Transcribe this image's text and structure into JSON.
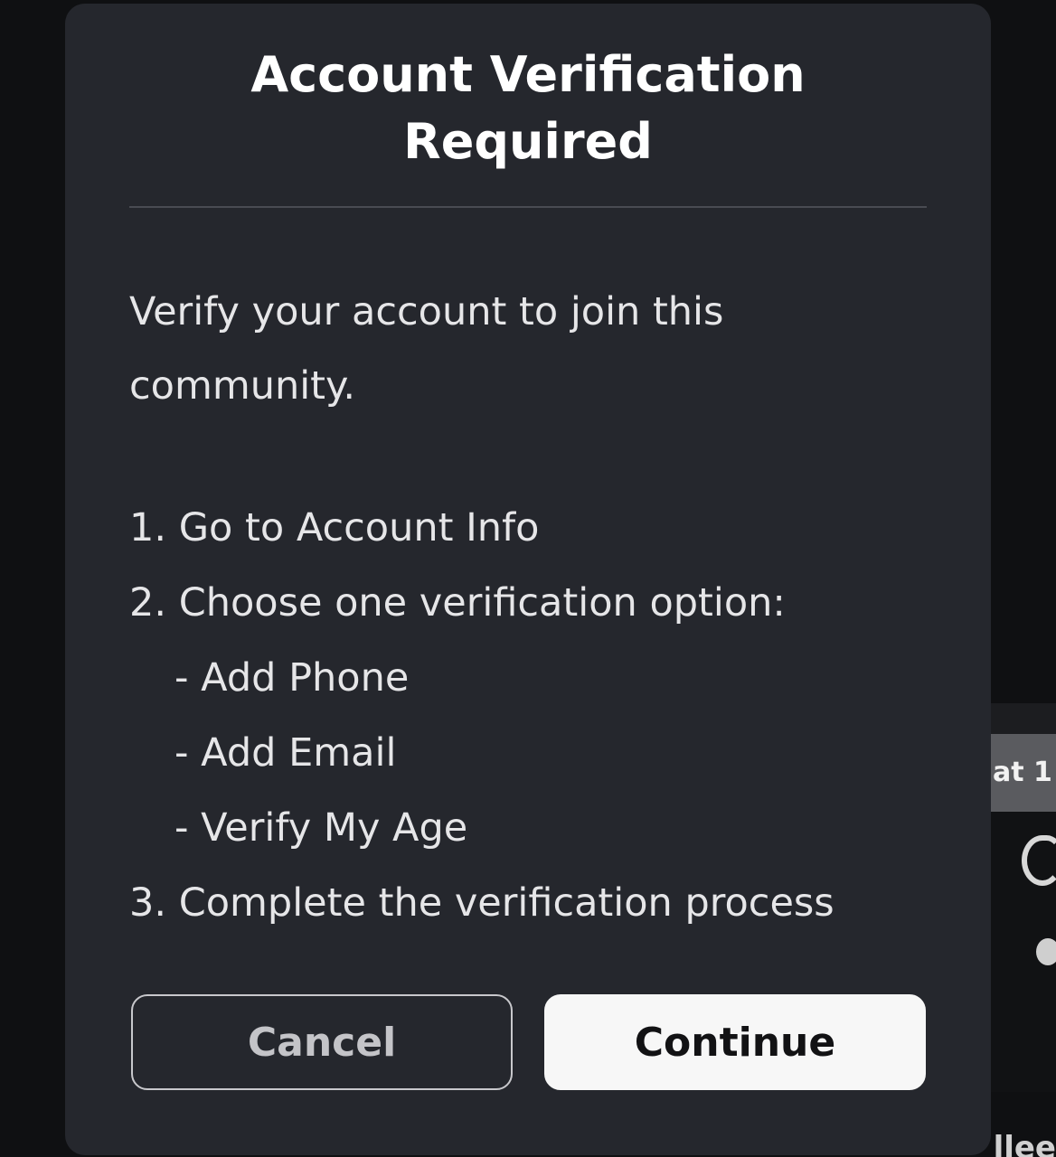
{
  "background": {
    "card_tag_text": "at 1",
    "bottom_text": "llee"
  },
  "dialog": {
    "title_line1": "Account Verification",
    "title_line2": "Required",
    "intro": "Verify your account to join this community.",
    "steps": [
      "1. Go to Account Info",
      "2. Choose one verification option:",
      "- Add Phone",
      "- Add Email",
      "- Verify My Age",
      "3. Complete the verification process"
    ],
    "cancel_label": "Cancel",
    "continue_label": "Continue"
  },
  "colors": {
    "dialog_bg": "#25272d",
    "page_bg": "#0f1012",
    "primary_button_bg": "#f7f7f7",
    "text": "#e6e6e8"
  }
}
